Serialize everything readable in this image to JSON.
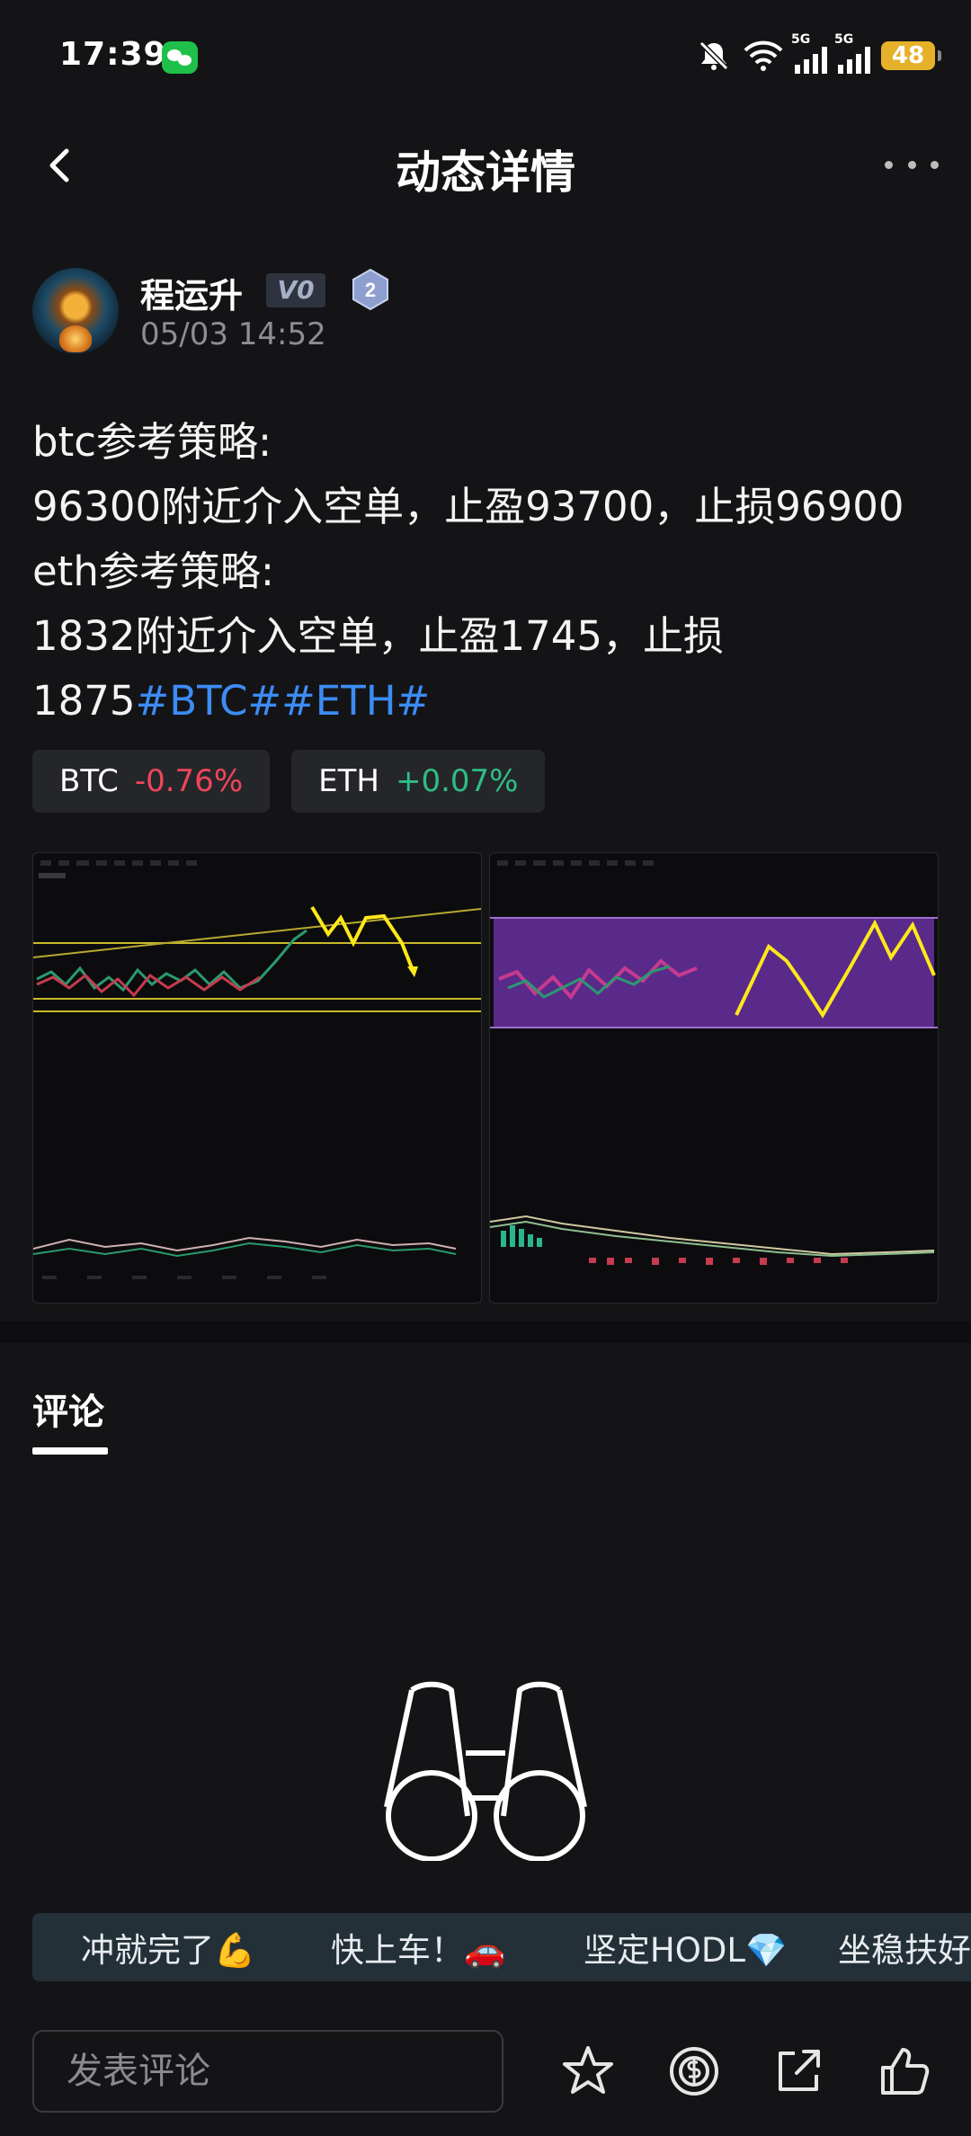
{
  "status_bar": {
    "time": "17:39",
    "network_1": "5G",
    "network_2": "5G",
    "battery": "48",
    "icons": [
      "wechat-icon",
      "mute-bell-icon",
      "wifi-icon",
      "signal-icon",
      "signal-icon",
      "battery-icon"
    ]
  },
  "header": {
    "title": "动态详情",
    "back_icon": "chevron-left-icon",
    "more_icon": "more-dots-icon"
  },
  "author": {
    "name": "程运升",
    "vip_badge": "V0",
    "level": "2",
    "time": "05/03 14:52"
  },
  "post": {
    "line1": "btc参考策略:",
    "line2": "96300附近介入空单，止盈93700，止损96900",
    "line3": "eth参考策略:",
    "line4": "1832附近介入空单，止盈1745，止损",
    "line5_text": "1875",
    "line5_tags": "#BTC##ETH#"
  },
  "tickers": [
    {
      "symbol": "BTC",
      "change": "-0.76%"
    },
    {
      "symbol": "ETH",
      "change": "+0.07%"
    }
  ],
  "colors": {
    "accent_blue": "#3c8cf5",
    "down_red": "#f0455a",
    "up_green": "#2fbd85",
    "chart_yellow": "#ffe81a",
    "chart_purple": "#5a2a8a"
  },
  "comments": {
    "tab_label": "评论",
    "empty_icon": "binoculars-icon",
    "quick_replies": [
      "冲就完了💪",
      "快上车！🚗",
      "坚定HODL💎",
      "坐稳扶好"
    ]
  },
  "bottom_bar": {
    "placeholder": "发表评论",
    "icons": [
      "star-icon",
      "tip-coin-icon",
      "share-icon",
      "like-icon"
    ]
  }
}
